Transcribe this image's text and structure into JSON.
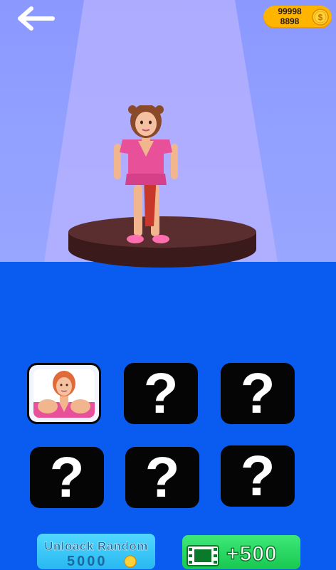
{
  "header": {
    "back_icon": "back-arrow-icon",
    "coins_line1": "99998",
    "coins_line2": "8898",
    "coin_icon_symbol": "$"
  },
  "colors": {
    "stage": "#98a6ff",
    "panel": "#0a5cf0",
    "coin": "#ffb400",
    "unlock_button": "#28b8f0",
    "ad_button": "#18c850"
  },
  "collection": {
    "slots": [
      {
        "state": "unlocked",
        "label": ""
      },
      {
        "state": "locked",
        "label": "?"
      },
      {
        "state": "locked",
        "label": "?"
      },
      {
        "state": "locked",
        "label": "?"
      },
      {
        "state": "locked",
        "label": "?"
      },
      {
        "state": "locked",
        "label": "?"
      }
    ]
  },
  "buttons": {
    "unlock_label": "Unloack Random",
    "unlock_price": "5000",
    "ad_icon": "film-icon",
    "ad_reward": "+500"
  }
}
